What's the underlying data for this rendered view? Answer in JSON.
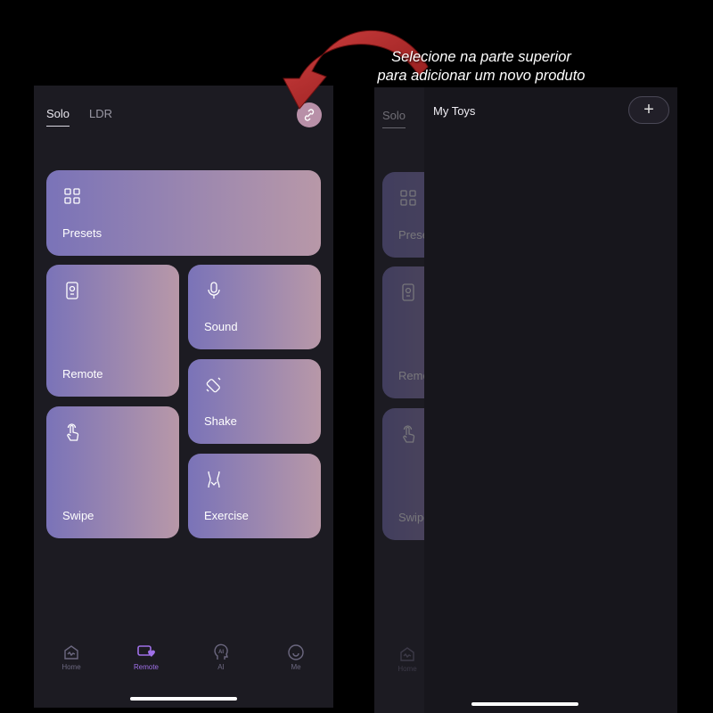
{
  "annotation": {
    "line1": "Selecione na parte superior",
    "line2": "para adicionar um novo produto",
    "arrow_color": "#b52a2a"
  },
  "header": {
    "tabs": [
      {
        "label": "Solo",
        "active": true
      },
      {
        "label": "LDR",
        "active": false
      }
    ],
    "link_icon": "unlink-icon"
  },
  "cards": [
    {
      "label": "Presets",
      "icon": "grid-icon"
    },
    {
      "label": "Remote",
      "icon": "remote-icon"
    },
    {
      "label": "Sound",
      "icon": "microphone-icon"
    },
    {
      "label": "Shake",
      "icon": "shake-icon"
    },
    {
      "label": "Swipe",
      "icon": "hand-pointer-icon"
    },
    {
      "label": "Exercise",
      "icon": "body-icon"
    }
  ],
  "bottom_nav": [
    {
      "label": "Home",
      "icon": "home-icon"
    },
    {
      "label": "Remote",
      "icon": "remote-hearts-icon",
      "active": true
    },
    {
      "label": "AI",
      "icon": "ai-head-icon"
    },
    {
      "label": "Me",
      "icon": "smile-icon"
    }
  ],
  "toys_panel": {
    "title": "My Toys",
    "add_label": "+"
  },
  "colors": {
    "card_start": "#7a73b8",
    "card_end": "#b898a8",
    "nav_active": "#9f70e8",
    "background": "#1c1b22"
  }
}
